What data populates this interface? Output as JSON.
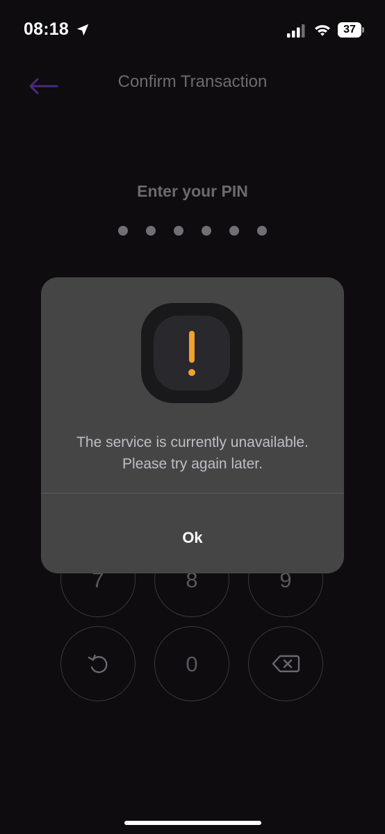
{
  "status_bar": {
    "time": "08:18",
    "battery_level": "37",
    "icons": [
      "location-arrow-icon",
      "cellular-signal-icon",
      "wifi-icon",
      "battery-icon"
    ]
  },
  "header": {
    "title": "Confirm Transaction",
    "back_icon": "arrow-left-icon",
    "back_color": "#4b2a7a"
  },
  "pin": {
    "prompt": "Enter your PIN",
    "dot_count": 6
  },
  "keypad": {
    "row_partial": [
      "7",
      "8",
      "9"
    ],
    "bottom": {
      "left_icon": "refresh-icon",
      "middle": "0",
      "right_icon": "backspace-icon"
    }
  },
  "dialog": {
    "icon": "warning-exclamation-icon",
    "icon_color": "#f0a130",
    "message_line1": "The service is currently unavailable.",
    "message_line2": "Please try again later.",
    "ok_label": "Ok"
  }
}
